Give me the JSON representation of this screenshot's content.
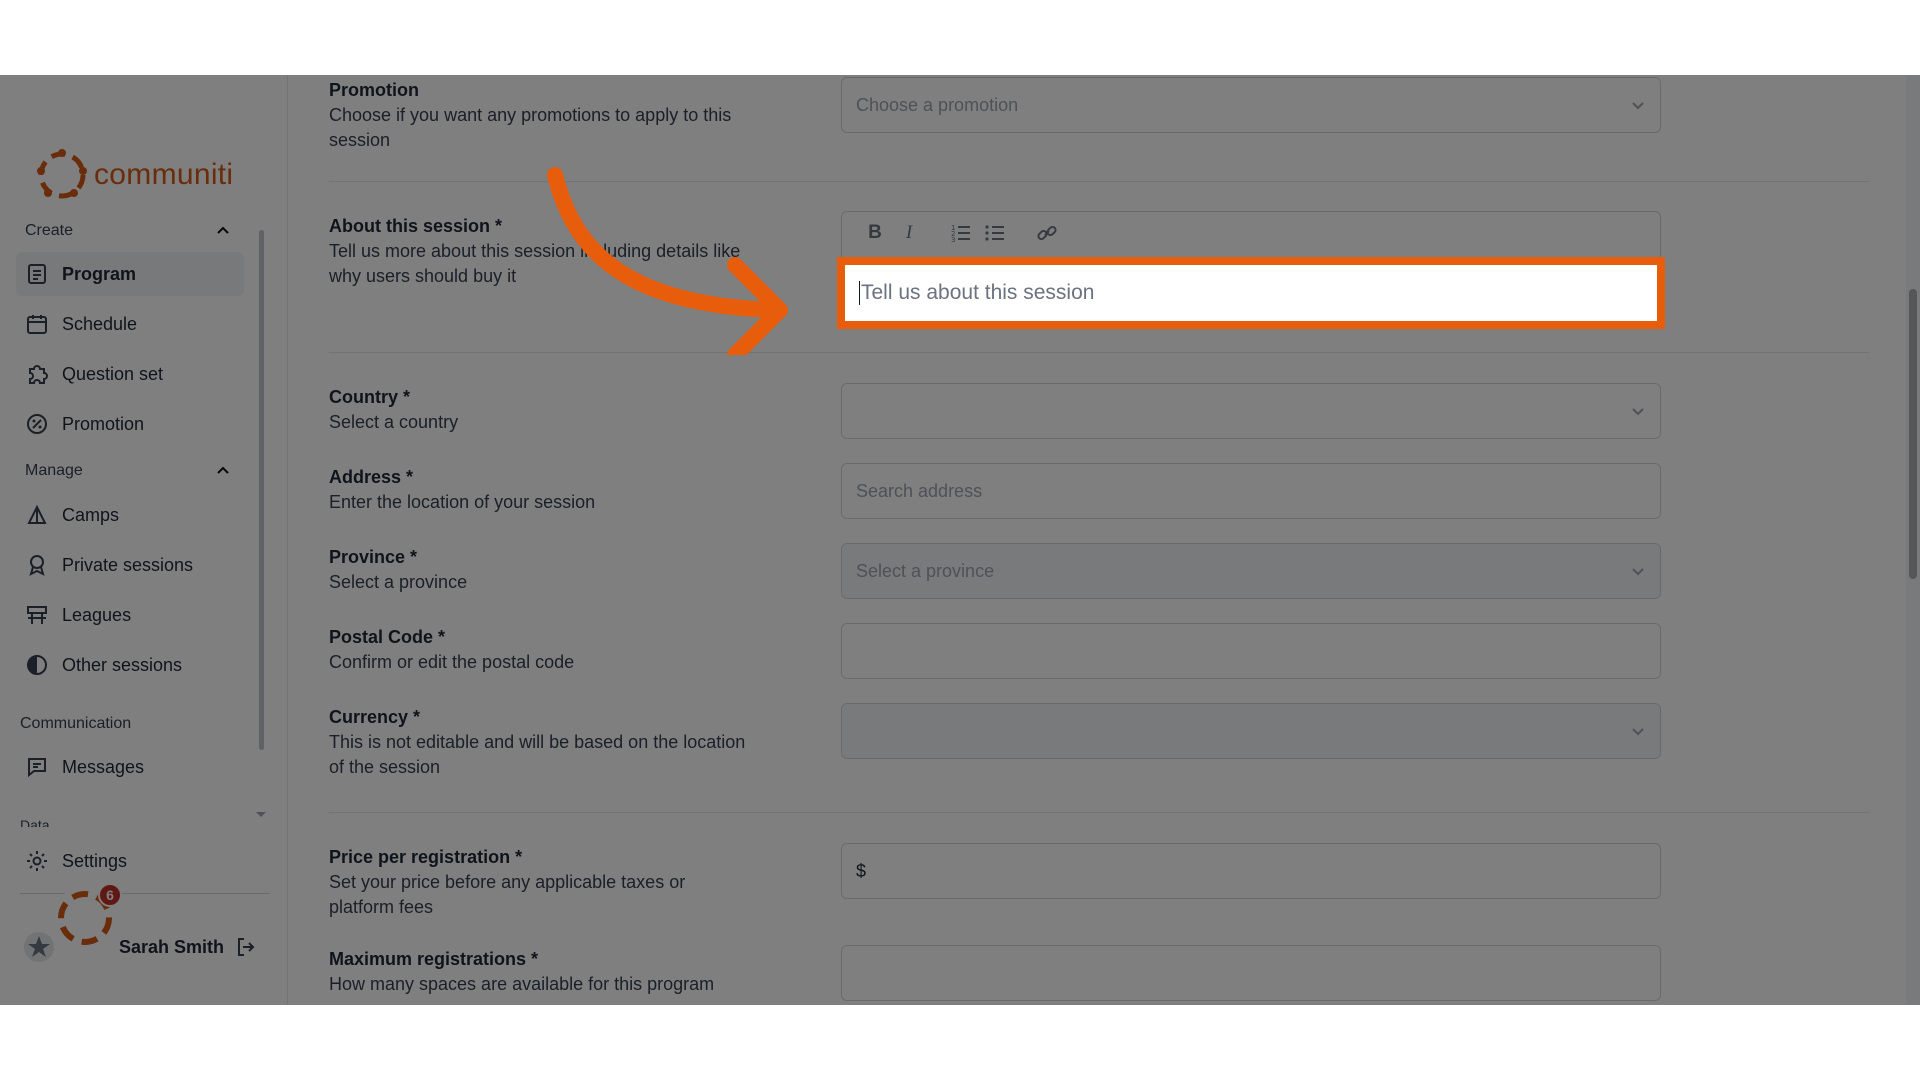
{
  "brand": {
    "name": "communiti",
    "accent": "#d25a16"
  },
  "sidebar": {
    "sections": [
      {
        "label": "Create",
        "items": [
          {
            "label": "Program",
            "icon": "document-list-icon",
            "active": true
          },
          {
            "label": "Schedule",
            "icon": "calendar-icon"
          },
          {
            "label": "Question set",
            "icon": "puzzle-icon"
          },
          {
            "label": "Promotion",
            "icon": "percent-badge-icon"
          }
        ]
      },
      {
        "label": "Manage",
        "items": [
          {
            "label": "Camps",
            "icon": "camp-icon"
          },
          {
            "label": "Private sessions",
            "icon": "award-icon"
          },
          {
            "label": "Leagues",
            "icon": "bracket-icon"
          },
          {
            "label": "Other sessions",
            "icon": "half-circle-icon"
          }
        ]
      },
      {
        "label": "Communication",
        "items": [
          {
            "label": "Messages",
            "icon": "message-icon"
          }
        ]
      },
      {
        "label": "Data"
      }
    ],
    "settings_label": "Settings",
    "user_name": "Sarah Smith",
    "notification_count": "6"
  },
  "form": {
    "promotion": {
      "title": "Promotion",
      "desc": "Choose if you want any promotions to apply to this session",
      "placeholder": "Choose a promotion"
    },
    "about": {
      "title": "About this session *",
      "desc": "Tell us more about this session including details like why users should buy it",
      "placeholder": "Tell us about this session"
    },
    "country": {
      "title": "Country *",
      "desc": "Select a country",
      "value": ""
    },
    "address": {
      "title": "Address *",
      "desc": "Enter the location of your session",
      "placeholder": "Search address"
    },
    "province": {
      "title": "Province *",
      "desc": "Select a province",
      "placeholder": "Select a province"
    },
    "postal": {
      "title": "Postal Code *",
      "desc": "Confirm or edit the postal code",
      "value": ""
    },
    "currency": {
      "title": "Currency *",
      "desc": "This is not editable and will be based on the location of the session",
      "value": ""
    },
    "price": {
      "title": "Price per registration *",
      "desc": "Set your price before any applicable taxes or platform fees",
      "prefix": "$"
    },
    "max_reg": {
      "title": "Maximum registrations *",
      "desc": "How many spaces are available for this program",
      "value": ""
    }
  },
  "highlight_color": "#e85d0c"
}
